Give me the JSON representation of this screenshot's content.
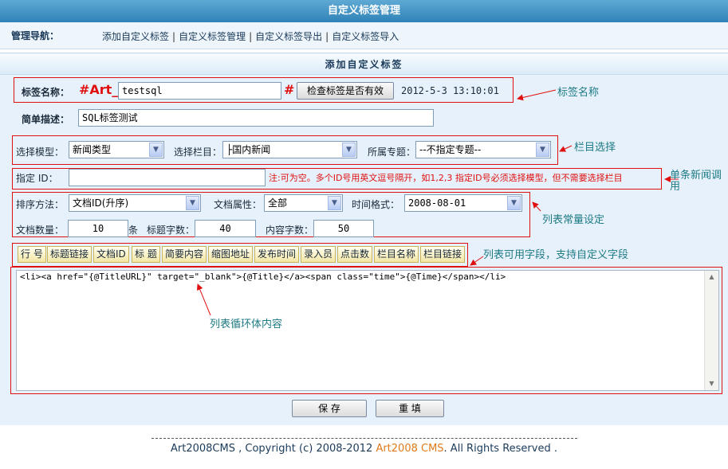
{
  "window": {
    "title": "自定义标签管理"
  },
  "nav": {
    "label": "管理导航：",
    "links": [
      "添加自定义标签",
      "自定义标签管理",
      "自定义标签导出",
      "自定义标签导入"
    ]
  },
  "form": {
    "title": "添加自定义标签",
    "tag_name": {
      "label": "标签名称：",
      "prefix": "#Art_",
      "value": "testsql",
      "suffix": "#",
      "check_button": "检查标签是否有效",
      "timestamp": "2012-5-3 13:10:01"
    },
    "description": {
      "label": "简单描述：",
      "value": "SQL标签测试"
    },
    "model": {
      "label": "选择模型：",
      "value": "新闻类型"
    },
    "column": {
      "label": "选择栏目：",
      "value": "├国内新闻"
    },
    "topic": {
      "label": "所属专题：",
      "value": "--不指定专题--"
    },
    "id_field": {
      "label": "指定 ID：",
      "value": "",
      "note": "注:可为空。多个ID号用英文逗号隔开，如1,2,3 指定ID号必须选择模型，但不需要选择栏目"
    },
    "sort": {
      "label": "排序方法：",
      "value": "文档ID(升序)"
    },
    "attr": {
      "label": "文档属性：",
      "value": "全部"
    },
    "time_format": {
      "label": "时间格式：",
      "value": "2008-08-01"
    },
    "doc_count": {
      "label": "文档数量：",
      "value": "10",
      "unit": "条"
    },
    "title_len": {
      "label": "标题字数：",
      "value": "40"
    },
    "content_len": {
      "label": "内容字数：",
      "value": "50"
    },
    "fields": [
      "行 号",
      "标题链接",
      "文档ID",
      "标 题",
      "简要内容",
      "缩图地址",
      "发布时间",
      "录入员",
      "点击数",
      "栏目名称",
      "栏目链接"
    ],
    "loop_content": "<li><a href=\"{@TitleURL}\" target=\"_blank\">{@Title}</a><span class=\"time\">{@Time}</span></li>",
    "save_button": "保 存",
    "reset_button": "重 填"
  },
  "annotations": {
    "tag_name": "标签名称",
    "column_select": "栏目选择",
    "single_news": "单条新闻调用",
    "list_const": "列表常量设定",
    "list_fields": "列表可用字段，支持自定义字段",
    "loop_body": "列表循环体内容"
  },
  "footer": {
    "before": "Art2008CMS , Copyright (c) 2008-2012 ",
    "brand": "Art2008 CMS",
    "after": ". All Rights Reserved ."
  },
  "colors": {
    "header_blue": "#2f82b8",
    "panel_bg": "#e6f1fb",
    "red_box": "#e01010",
    "annotation": "#1e7a84",
    "brand_orange": "#e07a1a"
  }
}
